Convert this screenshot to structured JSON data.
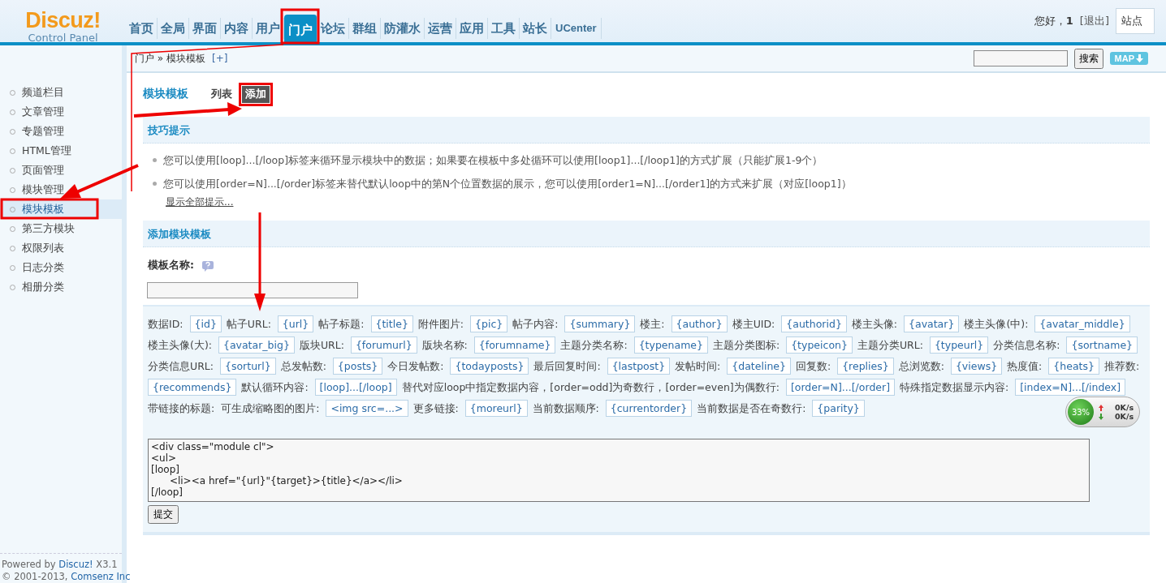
{
  "header": {
    "logo": "Discuz!",
    "logo_subtitle": "Control Panel",
    "nav": [
      {
        "label": "首页",
        "selected": false
      },
      {
        "label": "全局",
        "selected": false
      },
      {
        "label": "界面",
        "selected": false
      },
      {
        "label": "内容",
        "selected": false
      },
      {
        "label": "用户",
        "selected": false
      },
      {
        "label": "门户",
        "selected": true
      },
      {
        "label": "论坛",
        "selected": false
      },
      {
        "label": "群组",
        "selected": false
      },
      {
        "label": "防灌水",
        "selected": false
      },
      {
        "label": "运营",
        "selected": false
      },
      {
        "label": "应用",
        "selected": false
      },
      {
        "label": "工具",
        "selected": false
      },
      {
        "label": "站长",
        "selected": false
      },
      {
        "label": "UCenter",
        "selected": false
      }
    ],
    "greeting": "您好，",
    "user": "1",
    "logout": "[退出]",
    "site_button": "站点"
  },
  "breadcrumb": {
    "path": "门户 » 模块模板",
    "add": "[+]",
    "search_button": "搜索",
    "map_button": "MAP"
  },
  "sidebar": {
    "items": [
      {
        "label": "频道栏目",
        "selected": false
      },
      {
        "label": "文章管理",
        "selected": false
      },
      {
        "label": "专题管理",
        "selected": false
      },
      {
        "label": "HTML管理",
        "selected": false
      },
      {
        "label": "页面管理",
        "selected": false
      },
      {
        "label": "模块管理",
        "selected": false
      },
      {
        "label": "模块模板",
        "selected": true
      },
      {
        "label": "第三方模块",
        "selected": false
      },
      {
        "label": "权限列表",
        "selected": false
      },
      {
        "label": "日志分类",
        "selected": false
      },
      {
        "label": "相册分类",
        "selected": false
      }
    ],
    "powered": "Powered by",
    "powered_link": "Discuz!",
    "version": "X3.1",
    "copyright": "© 2001-2013,",
    "company": "Comsenz Inc"
  },
  "main": {
    "title": "模块模板",
    "tabs": [
      {
        "label": "列表",
        "selected": false
      },
      {
        "label": "添加",
        "selected": true
      }
    ],
    "tips_title": "技巧提示",
    "tips": [
      "您可以使用[loop]...[/loop]标签来循环显示模块中的数据；如果要在模板中多处循环可以使用[loop1]...[/loop1]的方式扩展（只能扩展1-9个）",
      "您可以使用[order=N]...[/order]标签来替代默认loop中的第N个位置数据的展示，您可以使用[order1=N]...[/order1]的方式来扩展（对应[loop1]）"
    ],
    "tips_more": "显示全部提示...",
    "form_title": "添加模块模板",
    "name_label": "模板名称:",
    "variables": [
      {
        "label": "数据ID:",
        "tag": "{id}"
      },
      {
        "label": "帖子URL:",
        "tag": "{url}"
      },
      {
        "label": "帖子标题:",
        "tag": "{title}"
      },
      {
        "label": "附件图片:",
        "tag": "{pic}"
      },
      {
        "label": "帖子内容:",
        "tag": "{summary}"
      },
      {
        "label": "楼主:",
        "tag": "{author}"
      },
      {
        "label": "楼主UID:",
        "tag": "{authorid}"
      },
      {
        "label": "楼主头像:",
        "tag": "{avatar}"
      },
      {
        "label": "楼主头像(中):",
        "tag": "{avatar_middle}"
      },
      {
        "label": "楼主头像(大):",
        "tag": "{avatar_big}"
      },
      {
        "label": "版块URL:",
        "tag": "{forumurl}"
      },
      {
        "label": "版块名称:",
        "tag": "{forumname}"
      },
      {
        "label": "主题分类名称:",
        "tag": "{typename}"
      },
      {
        "label": "主题分类图标:",
        "tag": "{typeicon}"
      },
      {
        "label": "主题分类URL:",
        "tag": "{typeurl}"
      },
      {
        "label": "分类信息名称:",
        "tag": "{sortname}"
      },
      {
        "label": "分类信息URL:",
        "tag": "{sorturl}"
      },
      {
        "label": "总发帖数:",
        "tag": "{posts}"
      },
      {
        "label": "今日发帖数:",
        "tag": "{todayposts}"
      },
      {
        "label": "最后回复时间:",
        "tag": "{lastpost}"
      },
      {
        "label": "发帖时间:",
        "tag": "{dateline}"
      },
      {
        "label": "回复数:",
        "tag": "{replies}"
      },
      {
        "label": "总浏览数:",
        "tag": "{views}"
      },
      {
        "label": "热度值:",
        "tag": "{heats}"
      },
      {
        "label": "推荐数:",
        "tag": "{recommends}"
      },
      {
        "label": "默认循环内容:",
        "tag": "[loop]...[/loop]"
      },
      {
        "label": "替代对应loop中指定数据内容，[order=odd]为奇数行，[order=even]为偶数行:",
        "tag": "[order=N]...[/order]"
      },
      {
        "label": "特殊指定数据显示内容:",
        "tag": "[index=N]...[/index]"
      },
      {
        "label": "带链接的标题:"
      },
      {
        "label": "可生成缩略图的图片:",
        "tag": "<img src=...>"
      },
      {
        "label": "更多链接:",
        "tag": "{moreurl}"
      },
      {
        "label": "当前数据顺序:",
        "tag": "{currentorder}"
      },
      {
        "label": "当前数据是否在奇数行:",
        "tag": "{parity}"
      }
    ],
    "template": "<div class=\"module cl\">\n<ul>\n[loop]\n\t<li><a href=\"{url}\"{target}>{title}</a></li>\n[/loop]",
    "submit": "提交"
  },
  "net_widget": {
    "percent": "33%",
    "up": "0K/s",
    "down": "0K/s"
  }
}
